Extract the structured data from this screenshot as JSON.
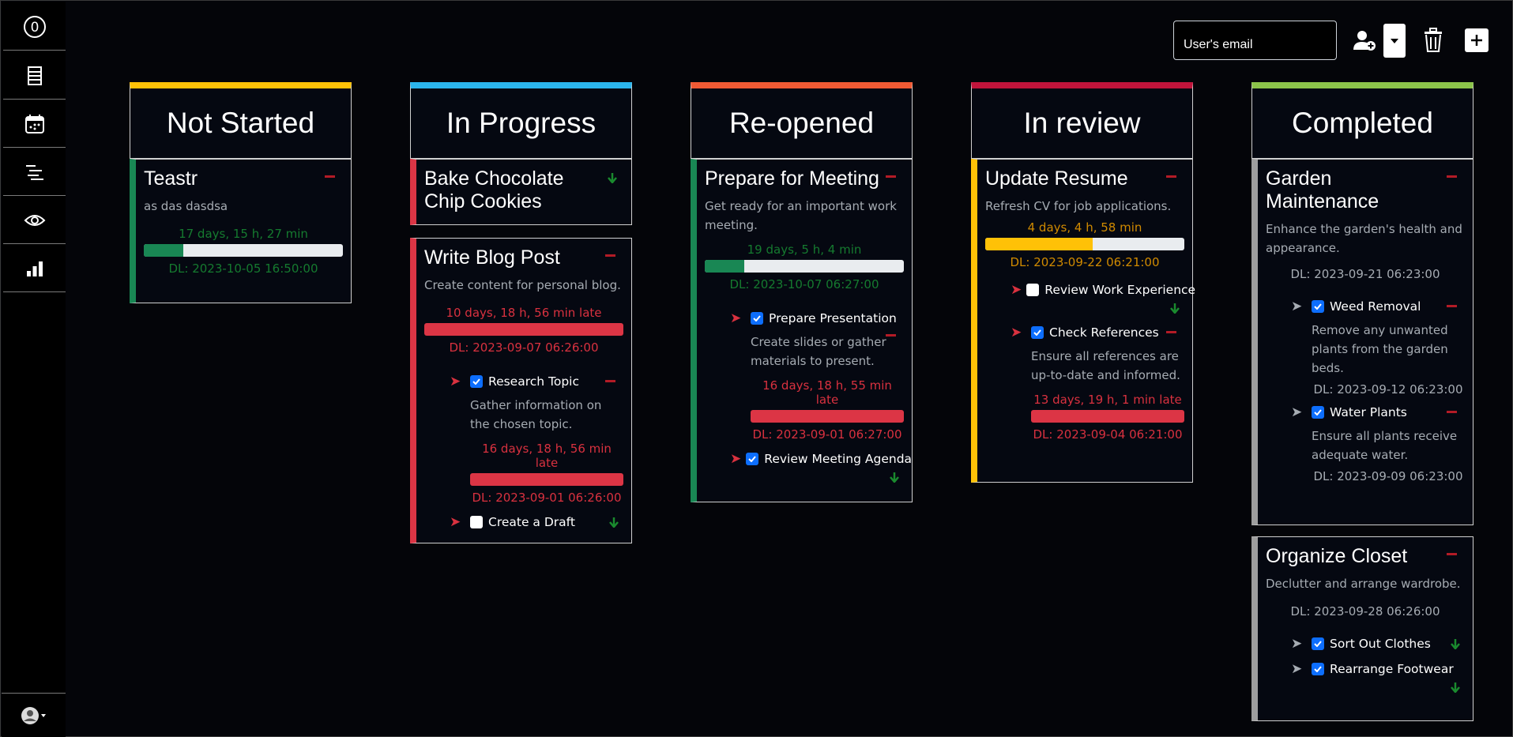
{
  "toolbar": {
    "email_placeholder": "User's email",
    "icons": [
      "add-user-icon",
      "caret-down-icon",
      "trash-icon",
      "plus-icon"
    ]
  },
  "sidebar": {
    "items": [
      "logo-icon",
      "board-icon",
      "calendar-icon",
      "gantt-icon",
      "eye-icon",
      "stats-icon"
    ],
    "profile": "avatar-icon"
  },
  "colors": {
    "not_started": "#ffc107",
    "in_progress": "#2bb5ec",
    "reopened": "#f15a34",
    "in_review": "#c0143b",
    "completed": "#8cc34a",
    "late_red": "#dc3545",
    "ontime_green": "#198754",
    "warning_yellow": "#ffc107"
  },
  "columns": [
    {
      "title": "Not Started",
      "cards": [
        {
          "title": "Teastr",
          "desc": "as das dasdsa",
          "time": "17 days, 15 h, 27 min",
          "progress": 0.2,
          "deadline": "DL: 2023-10-05 16:50:00"
        }
      ]
    },
    {
      "title": "In Progress",
      "cards": [
        {
          "title": "Bake Chocolate Chip Cookies"
        },
        {
          "title": "Write Blog Post",
          "desc": "Create content for personal blog.",
          "time": "10 days, 18 h, 56 min late",
          "progress": 1.0,
          "deadline": "DL: 2023-09-07 06:26:00",
          "subtasks": [
            {
              "title": "Research Topic",
              "checked": true,
              "desc": "Gather information on the chosen topic.",
              "time": "16 days, 18 h, 56 min late",
              "progress": 1.0,
              "deadline": "DL: 2023-09-01 06:26:00"
            },
            {
              "title": "Create a Draft",
              "checked": false
            }
          ]
        }
      ]
    },
    {
      "title": "Re-opened",
      "cards": [
        {
          "title": "Prepare for Meeting",
          "desc": "Get ready for an important work meeting.",
          "time": "19 days, 5 h, 4 min",
          "progress": 0.2,
          "deadline": "DL: 2023-10-07 06:27:00",
          "subtasks": [
            {
              "title": "Prepare Presentation",
              "checked": true,
              "desc": "Create slides or gather materials to present.",
              "time": "16 days, 18 h, 55 min late",
              "progress": 1.0,
              "deadline": "DL: 2023-09-01 06:27:00"
            },
            {
              "title": "Review Meeting Agenda",
              "checked": true
            }
          ]
        }
      ]
    },
    {
      "title": "In review",
      "cards": [
        {
          "title": "Update Resume",
          "desc": "Refresh CV for job applications.",
          "time": "4 days, 4 h, 58 min",
          "progress": 0.54,
          "deadline": "DL: 2023-09-22 06:21:00",
          "subtasks": [
            {
              "title": "Review Work Experience",
              "checked": false
            },
            {
              "title": "Check References",
              "checked": true,
              "desc": "Ensure all references are up-to-date and informed.",
              "time": "13 days, 19 h, 1 min late",
              "progress": 1.0,
              "deadline": "DL: 2023-09-04 06:21:00"
            }
          ]
        }
      ]
    },
    {
      "title": "Completed",
      "cards": [
        {
          "title": "Garden Maintenance",
          "desc": "Enhance the garden's health and appearance.",
          "deadline": "DL: 2023-09-21 06:23:00",
          "subtasks": [
            {
              "title": "Weed Removal",
              "checked": true,
              "desc": "Remove any unwanted plants from the garden beds.",
              "deadline": "DL: 2023-09-12 06:23:00"
            },
            {
              "title": "Water Plants",
              "checked": true,
              "desc": "Ensure all plants receive adequate water.",
              "deadline": "DL: 2023-09-09 06:23:00"
            }
          ]
        },
        {
          "title": "Organize Closet",
          "desc": "Declutter and arrange wardrobe.",
          "deadline": "DL: 2023-09-28 06:26:00",
          "subtasks": [
            {
              "title": "Sort Out Clothes",
              "checked": true
            },
            {
              "title": "Rearrange Footwear",
              "checked": true
            }
          ]
        }
      ]
    }
  ]
}
